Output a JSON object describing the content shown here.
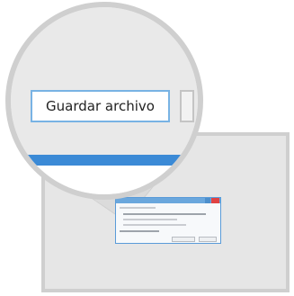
{
  "dialog": {
    "save_button_label": "Guardar archivo"
  },
  "colors": {
    "accent_blue": "#3b8ad6",
    "button_border": "#78b3e4",
    "window_gray": "#e6e6e6",
    "frame_gray": "#cfcfcf",
    "close_red": "#e04343"
  }
}
